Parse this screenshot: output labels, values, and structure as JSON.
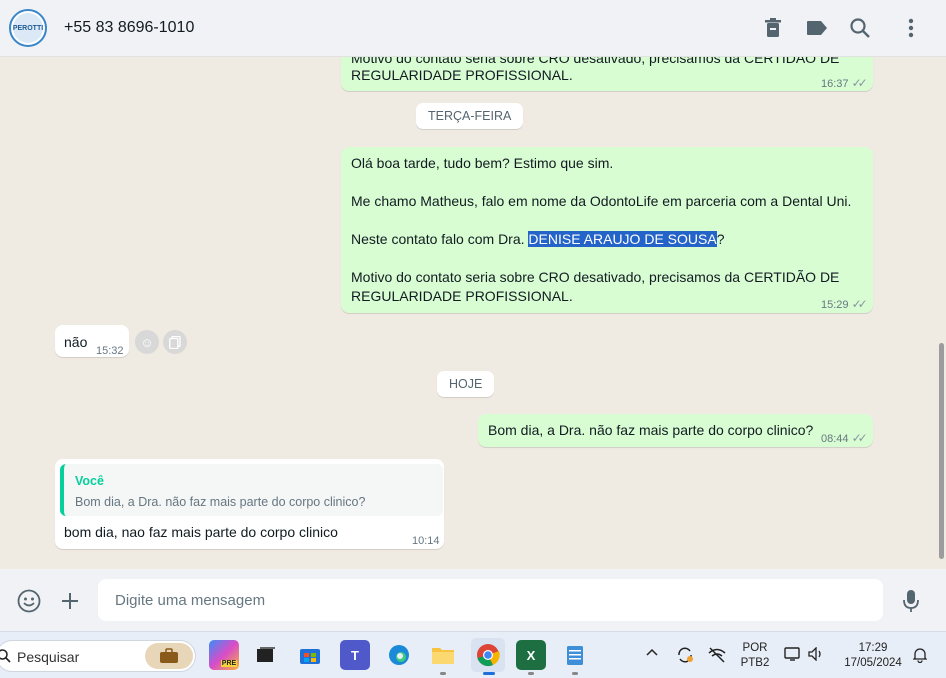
{
  "header": {
    "contact_name": "+55 83 8696-1010",
    "avatar_text": "PEROTTI",
    "icons": [
      "trash-icon",
      "label-icon",
      "search-icon",
      "menu-icon"
    ]
  },
  "messages": {
    "m1": {
      "line1": "Motivo do contato seria sobre CRO desativado, precisamos da CERTIDÃO DE",
      "line2": "REGULARIDADE PROFISSIONAL.",
      "time": "16:37"
    },
    "date1": "TERÇA-FEIRA",
    "m2": {
      "greeting": "Olá boa tarde, tudo bem? Estimo que sim.",
      "intro": "Me chamo Matheus, falo em nome da OdontoLife em parceria com a Dental Uni.",
      "contact_prefix": "Neste contato falo com Dra. ",
      "contact_name": "DENISE ARAUJO DE SOUSA",
      "contact_suffix": "?",
      "reason1": "Motivo do contato seria sobre CRO desativado, precisamos da CERTIDÃO DE",
      "reason2": "REGULARIDADE PROFISSIONAL.",
      "time": "15:29"
    },
    "m3": {
      "text": "não",
      "time": "15:32"
    },
    "date2": "HOJE",
    "m4": {
      "text": "Bom dia, a Dra. não faz mais parte do corpo clinico?",
      "time": "08:44"
    },
    "m5": {
      "quote_author": "Você",
      "quote_text": "Bom dia, a Dra. não faz mais parte do corpo clinico?",
      "text": "bom dia, nao faz mais parte do corpo clinico",
      "time": "10:14"
    }
  },
  "composer": {
    "placeholder": "Digite uma mensagem"
  },
  "taskbar": {
    "search_placeholder": "Pesquisar",
    "lang_top": "POR",
    "lang_bottom": "PTB2",
    "time": "17:29",
    "date": "17/05/2024"
  },
  "colors": {
    "outgoing": "#d9fdd3",
    "incoming": "#ffffff",
    "accent": "#06cf9c",
    "highlight": "#2463c8"
  }
}
